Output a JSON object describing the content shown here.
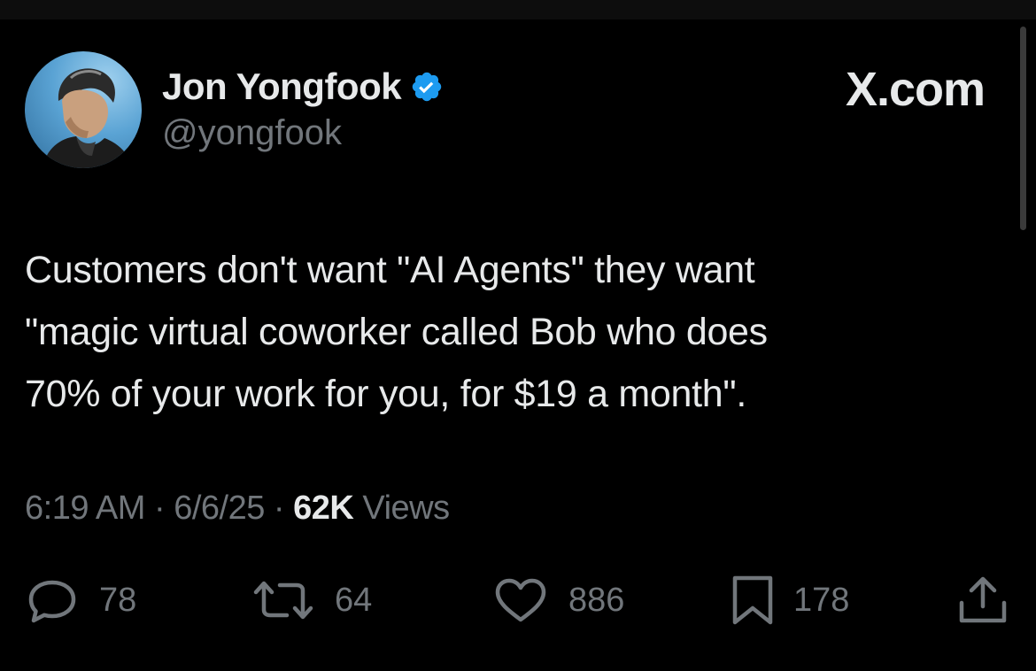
{
  "author": {
    "display_name": "Jon Yongfook",
    "handle": "@yongfook",
    "verified": true
  },
  "site_label": "X.com",
  "tweet": {
    "lines": [
      "Customers don't want \"AI Agents\" they want",
      "\"magic virtual coworker called Bob who does",
      "70% of your work for you, for $19 a month\"."
    ]
  },
  "meta": {
    "time": "6:19 AM",
    "separator": "·",
    "date": "6/6/25",
    "views_count": "62K",
    "views_label": "Views"
  },
  "actions": {
    "replies": {
      "icon": "reply-icon",
      "count": "78"
    },
    "reposts": {
      "icon": "repost-icon",
      "count": "64"
    },
    "likes": {
      "icon": "heart-icon",
      "count": "886"
    },
    "bookmarks": {
      "icon": "bookmark-icon",
      "count": "178"
    },
    "share": {
      "icon": "share-icon"
    }
  },
  "colors": {
    "background": "#000000",
    "primary_text": "#e7e9ea",
    "secondary_text": "#71767b",
    "verified_badge": "#1d9bf0"
  }
}
